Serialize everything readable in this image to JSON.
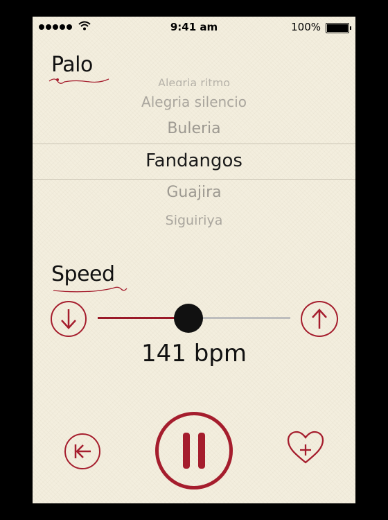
{
  "status_bar": {
    "time": "9:41 am",
    "battery": "100%"
  },
  "palo": {
    "heading": "Palo",
    "options": [
      {
        "label": "Alegria ritmo"
      },
      {
        "label": "Alegria silencio"
      },
      {
        "label": "Buleria"
      },
      {
        "label": "Fandangos"
      },
      {
        "label": "Guajira"
      },
      {
        "label": "Siguiriya"
      }
    ],
    "selected": "Fandangos"
  },
  "speed": {
    "heading": "Speed",
    "bpm_text": "141 bpm",
    "slider_fraction": 0.47
  },
  "colors": {
    "accent": "#a51d2d",
    "background": "#f3eede"
  },
  "controls": {
    "restart": "restart-icon",
    "pause": "pause-icon",
    "favorite": "heart-plus-icon"
  }
}
